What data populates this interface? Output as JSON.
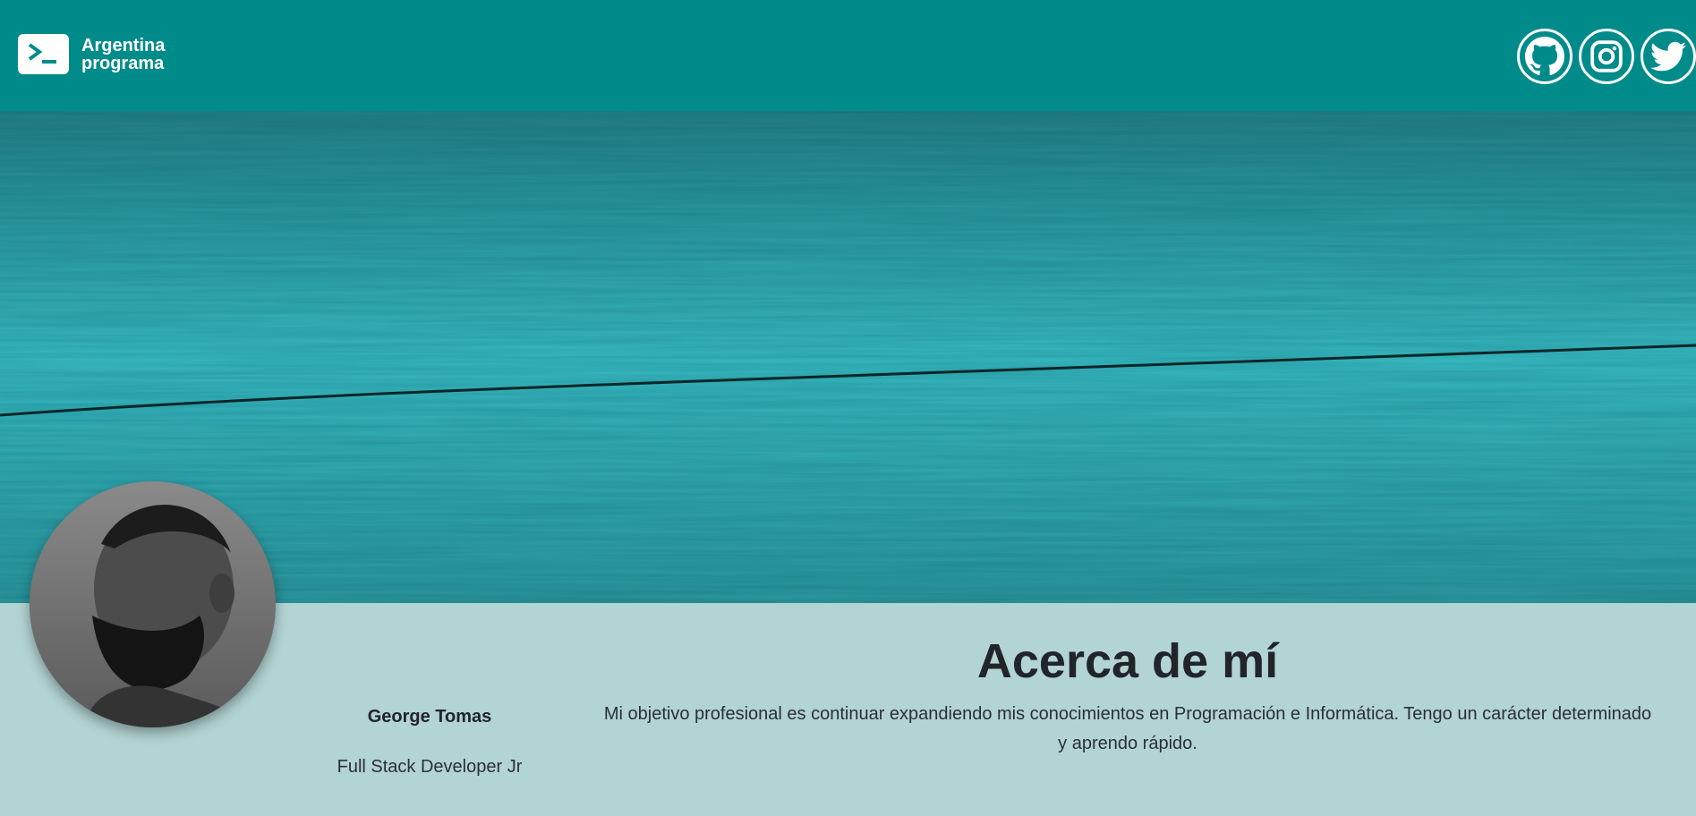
{
  "navbar": {
    "brand_line1": "Argentina",
    "brand_line2": "programa",
    "brand_icon": "terminal-prompt-icon",
    "socials": [
      {
        "name": "github",
        "icon": "github-icon"
      },
      {
        "name": "instagram",
        "icon": "instagram-icon"
      },
      {
        "name": "twitter",
        "icon": "twitter-icon"
      }
    ],
    "color": "#008b8b"
  },
  "banner": {
    "image": "teal-wood-texture",
    "color": "#1b8f98"
  },
  "profile": {
    "name": "George Tomas",
    "role": "Full Stack Developer Jr",
    "avatar": "grayscale-portrait-bearded-man"
  },
  "about": {
    "title": "Acerca de mí",
    "text": "Mi objetivo profesional es continuar expandiendo mis conocimientos en Programación e Informática. Tengo un carácter determinado y aprendo rápido."
  },
  "colors": {
    "page_bg": "#b2d4d3",
    "accent": "#008b8b"
  }
}
